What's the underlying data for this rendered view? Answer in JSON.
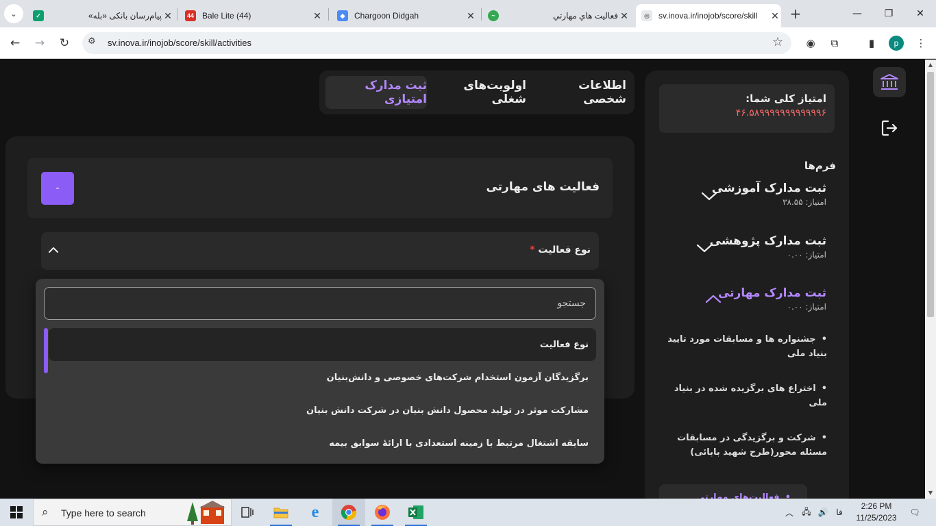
{
  "browser": {
    "tabs": [
      {
        "title": "پیام‌رسان بانکی «بله»",
        "favicon_color": "#0e9f6e",
        "rtl": true
      },
      {
        "title": "Bale Lite (44)",
        "badge": "44",
        "favicon_color": "#d93025",
        "rtl": false
      },
      {
        "title": "Chargoon Didgah",
        "favicon_color": "#4c8bf5",
        "rtl": false
      },
      {
        "title": "فعاليت هاي مهارتي",
        "favicon_color": "#34a853",
        "rtl": true
      },
      {
        "title": "sv.inova.ir/inojob/score/skill",
        "favicon_color": "#9aa0a6",
        "rtl": false,
        "active": true
      }
    ],
    "url": "sv.inova.ir/inojob/score/skill/activities",
    "profile_initial": "p",
    "extension_badge": "1"
  },
  "page": {
    "top_tabs": [
      {
        "label": "اطلاعات شخصی",
        "selected": false
      },
      {
        "label": "اولویت‌های شغلی",
        "selected": false
      },
      {
        "label": "ثبت مدارک امتیازی",
        "selected": true
      }
    ],
    "sidebar": {
      "score_label": "امتیاز کلی شما:",
      "score_value": "۴۶.۵۸۹۹۹۹۹۹۹۹۹۹۹۹۶",
      "forms_title": "فرم‌ها",
      "forms": [
        {
          "name": "ثبت مدارک آموزشی",
          "score": "امتیاز: ۳۸.۵۵",
          "expanded": false
        },
        {
          "name": "ثبت مدارک پژوهشی",
          "score": "امتیاز: ۰.۰۰",
          "expanded": false
        },
        {
          "name": "ثبت مدارک مهارتی",
          "score": "امتیاز: ۰.۰۰",
          "expanded": true
        }
      ],
      "sub_items": [
        "جشنواره ها و مسابقات مورد تایید بنیاد ملی",
        "اختراع های برگزیده شده در بنیاد ملی",
        "شرکت و برگزیدگی در مسابقات مسئله محور(طرح شهید بابائی)",
        "فعالیت‌های مهارتی"
      ],
      "bullet": "•"
    },
    "main": {
      "title": "فعالیت های مهارتی",
      "minus_label": "-",
      "field_label": "نوع فعالیت",
      "required_mark": "*"
    },
    "dropdown": {
      "search_placeholder": "جستجو",
      "options": [
        {
          "label": "نوع فعالیت",
          "selected": true
        },
        {
          "label": "برگزیدگان آزمون استخدام شرکت‌های خصوصی و دانش‌بنیان",
          "selected": false
        },
        {
          "label": "مشارکت موثر در تولید محصول دانش بنیان در شرکت دانش بنیان",
          "selected": false
        },
        {
          "label": "سابقه اشتغال مرتبط با زمینه استعدادی با ارائهٔ سوابق بیمه",
          "selected": false
        }
      ]
    },
    "colors": {
      "accent": "#8b5cf6",
      "accent_text": "#b388ff",
      "score_red": "#f26a6a",
      "background": "#121212"
    }
  },
  "taskbar": {
    "search_placeholder": "Type here to search",
    "apps": [
      "task-view",
      "file-explorer",
      "internet-explorer",
      "chrome",
      "firefox",
      "excel"
    ],
    "language": "فا",
    "time": "2:26 PM",
    "date": "11/25/2023",
    "notification_count": "1"
  }
}
